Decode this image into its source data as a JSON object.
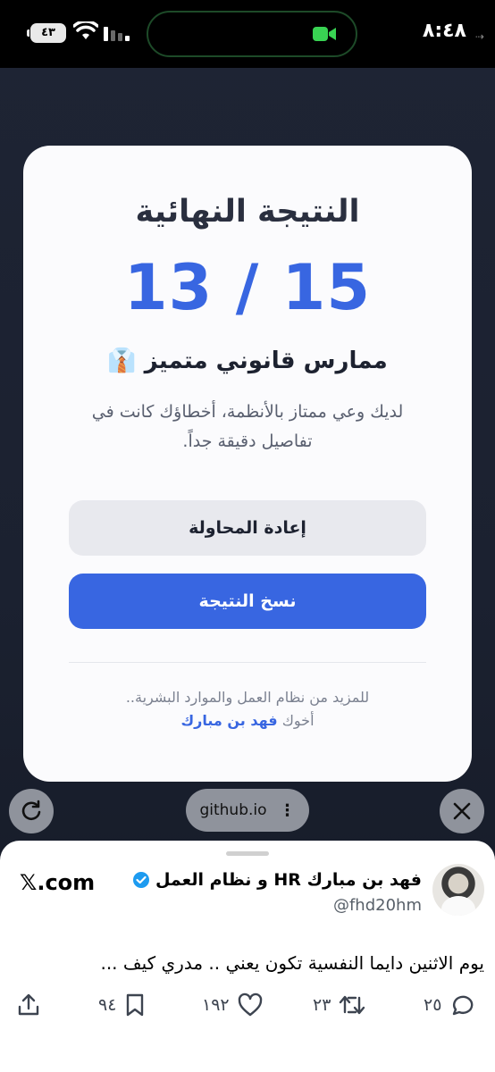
{
  "statusbar": {
    "time": "٨:٤٨",
    "battery": "٤٣"
  },
  "quiz": {
    "title": "النتيجة النهائية",
    "score": "13 / 15",
    "level": "ممارس قانوني متميز 👔",
    "description": "لديك وعي ممتاز بالأنظمة، أخطاؤك كانت في تفاصيل دقيقة جداً.",
    "retry_label": "إعادة المحاولة",
    "copy_label": "نسخ النتيجة",
    "footer_line": "للمزيد من نظام العمل والموارد البشرية..",
    "footer_prefix": "أخوك",
    "footer_author": "فهد بن مبارك"
  },
  "browser": {
    "url": "github.io",
    "url_menu_icon": "more-vertical-icon"
  },
  "tweet": {
    "author_name": "فهد بن مبارك HR و نظام العمل",
    "handle": "@fhd20hm",
    "site": "𝕏.com",
    "text": "يوم الاثنين دايما النفسية تكون يعني .. مدري كيف ...",
    "replies": "٢٥",
    "retweets": "٢٣",
    "likes": "١٩٢",
    "bookmarks": "٩٤"
  },
  "colors": {
    "accent": "#3866e1",
    "verified": "#1d9bf0"
  }
}
